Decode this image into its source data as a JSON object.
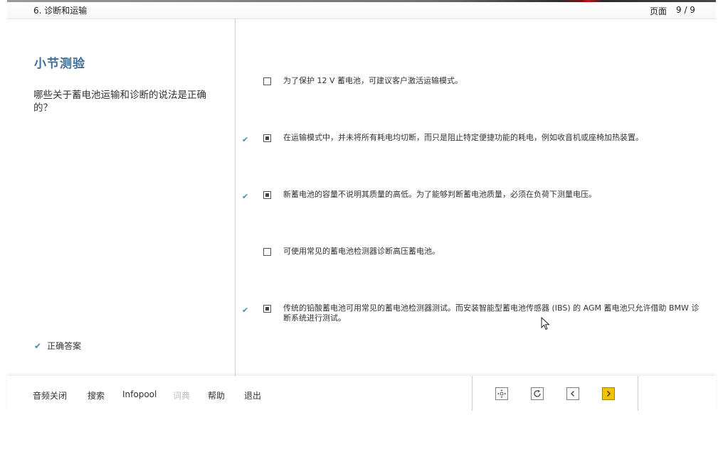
{
  "header": {
    "chapter": "6. 诊断和运输",
    "page_label": "页面",
    "page_number": "9 / 9"
  },
  "left": {
    "section_title": "小节测验",
    "question": "哪些关于蓄电池运输和诊断的说法是正确的？",
    "legend_label": "正确答案"
  },
  "answers": [
    {
      "text": "为了保护 12 V 蓄电池，可建议客户激活运输模式。",
      "checked": false,
      "correct": false
    },
    {
      "text": "在运输模式中，并未将所有耗电均切断，而只是阻止特定便捷功能的耗电，例如收音机或座椅加热装置。",
      "checked": true,
      "correct": true
    },
    {
      "text": "新蓄电池的容量不说明其质量的高低。为了能够判断蓄电池质量，必须在负荷下测量电压。",
      "checked": true,
      "correct": true
    },
    {
      "text": "可使用常见的蓄电池检测器诊断高压蓄电池。",
      "checked": false,
      "correct": false
    },
    {
      "text": "传统的铅酸蓄电池可用常见的蓄电池检测器测试。而安装智能型蓄电池传感器 (IBS) 的 AGM 蓄电池只允许借助 BMW 诊断系统进行测试。",
      "checked": true,
      "correct": true
    }
  ],
  "footer": {
    "menu": [
      {
        "label": "音频关闭",
        "enabled": true
      },
      {
        "label": "搜索",
        "enabled": true
      },
      {
        "label": "Infopool",
        "enabled": true
      },
      {
        "label": "词典",
        "enabled": false
      },
      {
        "label": "帮助",
        "enabled": true
      },
      {
        "label": "退出",
        "enabled": true
      }
    ],
    "nav_buttons": [
      {
        "icon": "navigate-icon"
      },
      {
        "icon": "refresh-icon"
      },
      {
        "icon": "chevron-left-icon"
      },
      {
        "icon": "chevron-right-icon",
        "active": true
      }
    ]
  },
  "colors": {
    "accent_title": "#3b6e9c",
    "check_mark": "#4a8aa8",
    "next_button": "#f2c200"
  }
}
